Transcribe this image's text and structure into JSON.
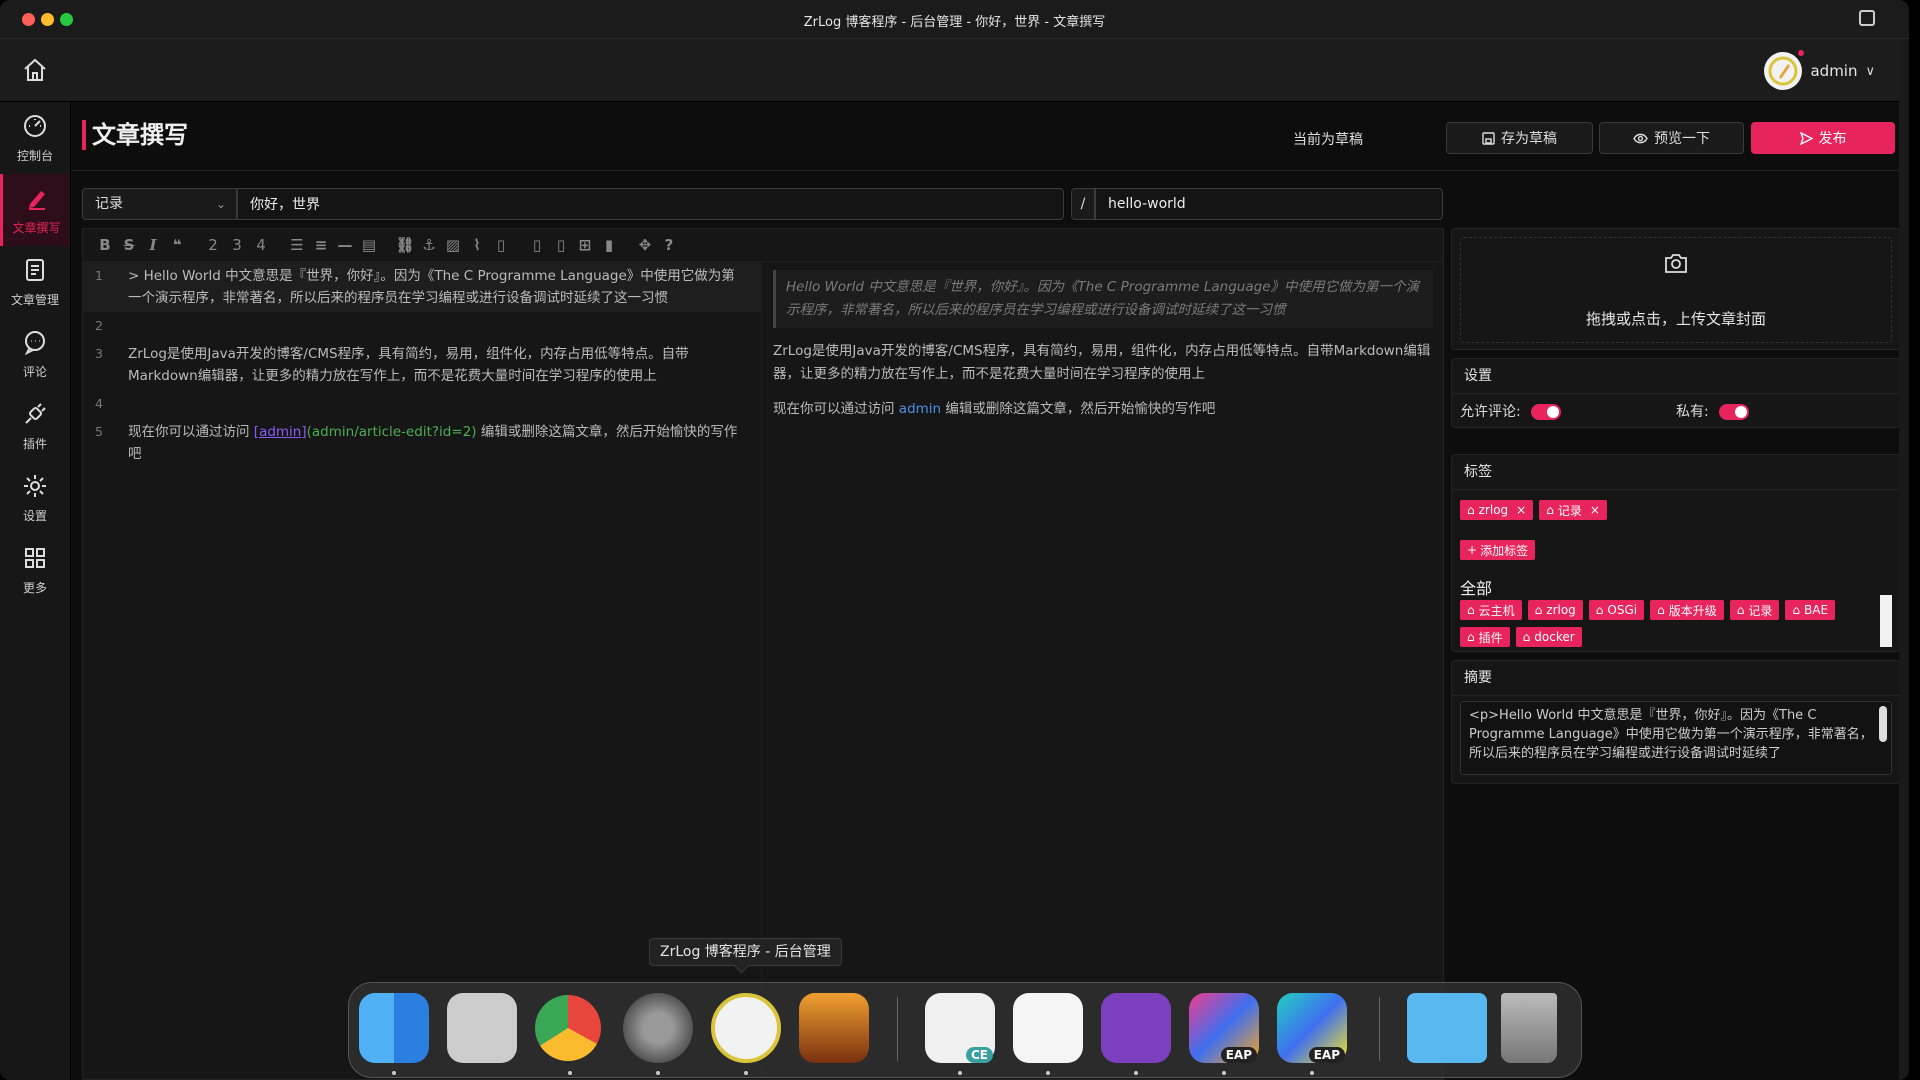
{
  "window": {
    "title": "ZrLog 博客程序 - 后台管理 - 你好，世界 - 文章撰写"
  },
  "topbar": {
    "username": "admin"
  },
  "sidebar": {
    "items": [
      {
        "label": "控制台",
        "icon": "dashboard-icon"
      },
      {
        "label": "文章撰写",
        "icon": "pen-icon",
        "active": true
      },
      {
        "label": "文章管理",
        "icon": "document-icon"
      },
      {
        "label": "评论",
        "icon": "comment-icon"
      },
      {
        "label": "插件",
        "icon": "plug-icon"
      },
      {
        "label": "设置",
        "icon": "gear-icon"
      },
      {
        "label": "更多",
        "icon": "grid-icon"
      }
    ]
  },
  "page": {
    "title": "文章撰写",
    "draft_status": "当前为草稿",
    "save_draft_label": "存为草稿",
    "preview_label": "预览一下",
    "publish_label": "发布"
  },
  "form": {
    "category": "记录",
    "title_value": "你好，世界",
    "slash": "/",
    "alias_value": "hello-world"
  },
  "editor": {
    "toolbar": [
      "bold-icon",
      "strikethrough-icon",
      "italic-icon",
      "quote-icon",
      "heading2-icon",
      "heading3-icon",
      "heading4-icon",
      "bullet-list-icon",
      "ordered-list-icon",
      "hr-icon",
      "code-block-icon",
      "link-icon",
      "anchor-icon",
      "image-icon",
      "attachment-icon",
      "file-icon",
      "file-icon-2",
      "file-icon-3",
      "table-icon",
      "clipboard-icon",
      "fullscreen-icon",
      "help-icon"
    ],
    "heading_digits": [
      "2",
      "3",
      "4"
    ],
    "line_numbers": [
      "1",
      "2",
      "3",
      "4",
      "5"
    ],
    "line1": "> Hello World 中文意思是『世界，你好』。因为《The C Programme Language》中使用它做为第一个演示程序，非常著名，所以后来的程序员在学习编程或进行设备调试时延续了这一习惯",
    "line3": "ZrLog是使用Java开发的博客/CMS程序，具有简约，易用，组件化，内存占用低等特点。自带Markdown编辑器，让更多的精力放在写作上，而不是花费大量时间在学习程序的使用上",
    "line5_prefix": "现在你可以通过访问 ",
    "line5_link_text": "[admin]",
    "line5_link_url": "(admin/article-edit?id=2)",
    "line5_suffix": " 编辑或删除这篇文章，然后开始愉快的写作吧"
  },
  "preview": {
    "quote": "Hello World 中文意思是『世界，你好』。因为《The C Programme Language》中使用它做为第一个演示程序，非常著名，所以后来的程序员在学习编程或进行设备调试时延续了这一习惯",
    "p1": "ZrLog是使用Java开发的博客/CMS程序，具有简约，易用，组件化，内存占用低等特点。自带Markdown编辑器，让更多的精力放在写作上，而不是花费大量时间在学习程序的使用上",
    "p2_prefix": "现在你可以通过访问 ",
    "p2_link": "admin",
    "p2_suffix": " 编辑或删除这篇文章，然后开始愉快的写作吧"
  },
  "cover": {
    "upload_label": "拖拽或点击，上传文章封面"
  },
  "settings": {
    "title": "设置",
    "allow_comment_label": "允许评论:",
    "allow_comment": true,
    "private_label": "私有:",
    "private": true
  },
  "tags": {
    "title": "标签",
    "selected": [
      "zrlog",
      "记录"
    ],
    "add_label": "添加标签",
    "all_title": "全部",
    "all": [
      "云主机",
      "zrlog",
      "OSGi",
      "版本升级",
      "记录",
      "BAE",
      "插件",
      "docker"
    ]
  },
  "summary": {
    "title": "摘要",
    "value": "<p>Hello World 中文意思是『世界，你好』。因为《The C Programme Language》中使用它做为第一个演示程序，非常著名，所以后来的程序员在学习编程或进行设备调试时延续了"
  },
  "dock": {
    "tooltip": "ZrLog 博客程序 - 后台管理",
    "apps": [
      "finder-icon",
      "launchpad-icon",
      "chrome-icon",
      "system-settings-icon",
      "zrlog-icon",
      "photo-app-icon",
      "dbeaver-icon",
      "chatgpt-icon",
      "github-desktop-icon",
      "intellij-icon",
      "webstorm-icon",
      "downloads-folder-icon",
      "trash-icon"
    ],
    "badges": {
      "intellij": "EAP",
      "webstorm": "EAP",
      "dbeaver": "CE"
    }
  },
  "colors": {
    "accent": "#e8245c",
    "background": "#0d0d0d"
  }
}
